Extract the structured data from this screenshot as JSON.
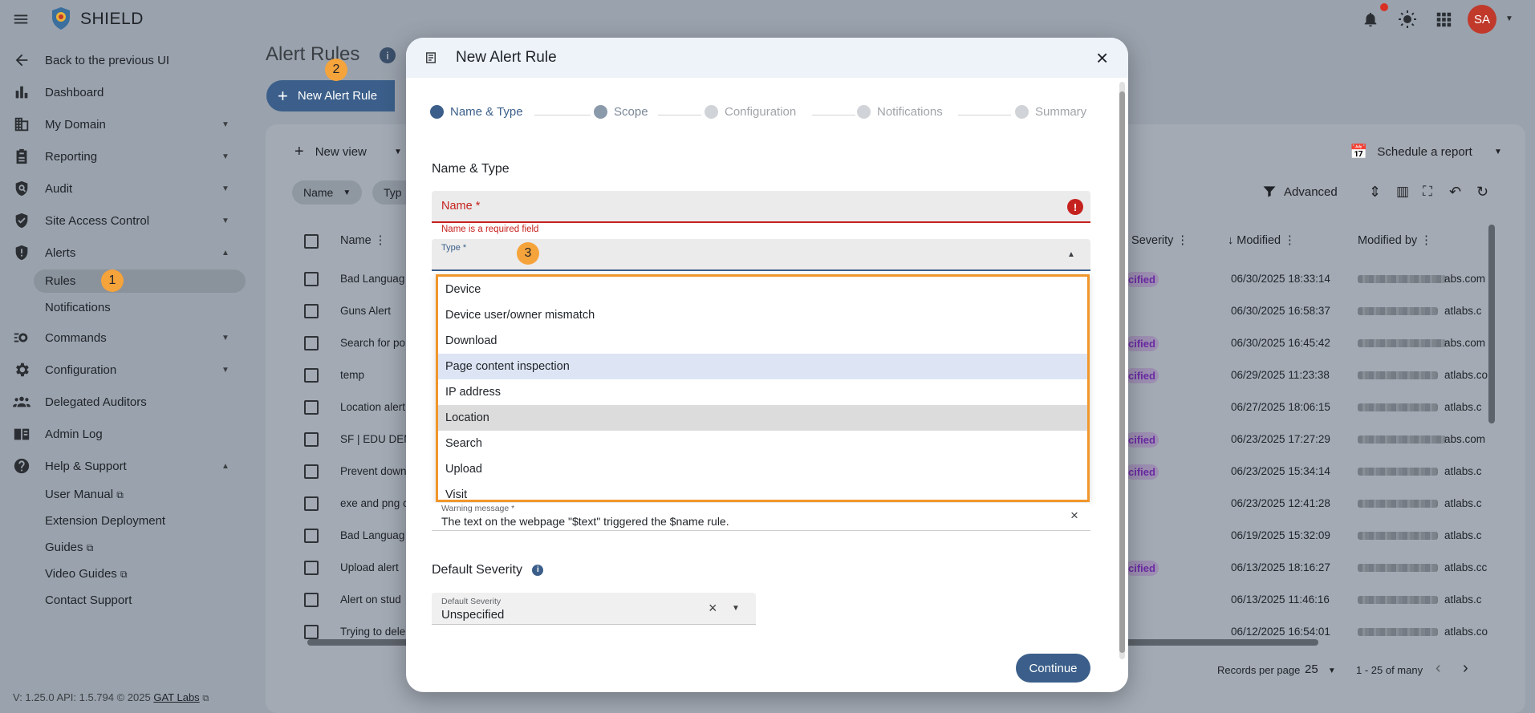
{
  "app": {
    "name": "SHIELD",
    "avatar": "SA"
  },
  "sidebar": {
    "back": "Back to the previous UI",
    "items": [
      {
        "label": "Dashboard"
      },
      {
        "label": "My Domain"
      },
      {
        "label": "Reporting"
      },
      {
        "label": "Audit"
      },
      {
        "label": "Site Access Control"
      },
      {
        "label": "Alerts"
      },
      {
        "label": "Commands"
      },
      {
        "label": "Configuration"
      },
      {
        "label": "Delegated Auditors"
      },
      {
        "label": "Admin Log"
      },
      {
        "label": "Help & Support"
      }
    ],
    "alerts_sub": [
      "Rules",
      "Notifications"
    ],
    "help_sub": [
      "User Manual",
      "Extension Deployment",
      "Guides",
      "Video Guides",
      "Contact Support"
    ],
    "footer": {
      "version": "V: 1.25.0  API: 1.5.794  © 2025",
      "link": "GAT Labs"
    }
  },
  "main": {
    "title": "Alert Rules",
    "new_rule_button": "New Alert Rule",
    "new_view": "New view",
    "schedule_report": "Schedule a report",
    "advanced": "Advanced",
    "filter_chips": [
      "Name",
      "Typ"
    ],
    "columns": {
      "name": "Name",
      "severity": "t Severity",
      "modified": "Modified",
      "modified_by": "Modified by"
    },
    "rows": [
      {
        "name": "Bad Languag",
        "severity": "cified",
        "modified": "06/30/2025 18:33:14",
        "by_tail": "abs.com"
      },
      {
        "name": "Guns Alert",
        "severity": "",
        "modified": "06/30/2025 16:58:37",
        "by_tail": "atlabs.c"
      },
      {
        "name": "Search for po",
        "severity": "cified",
        "modified": "06/30/2025 16:45:42",
        "by_tail": "abs.com"
      },
      {
        "name": "temp",
        "severity": "cified",
        "modified": "06/29/2025 11:23:38",
        "by_tail": "atlabs.co"
      },
      {
        "name": "Location alert",
        "severity": "",
        "modified": "06/27/2025 18:06:15",
        "by_tail": "atlabs.c"
      },
      {
        "name": "SF | EDU DEM",
        "severity": "cified",
        "modified": "06/23/2025 17:27:29",
        "by_tail": "abs.com"
      },
      {
        "name": "Prevent down",
        "severity": "cified",
        "modified": "06/23/2025 15:34:14",
        "by_tail": "atlabs.c"
      },
      {
        "name": "exe and png c",
        "severity": "",
        "modified": "06/23/2025 12:41:28",
        "by_tail": "atlabs.c"
      },
      {
        "name": "Bad Languag",
        "severity": "",
        "modified": "06/19/2025 15:32:09",
        "by_tail": "atlabs.c"
      },
      {
        "name": "Upload alert",
        "severity": "cified",
        "modified": "06/13/2025 18:16:27",
        "by_tail": "atlabs.cc"
      },
      {
        "name": "Alert on stud",
        "severity": "",
        "modified": "06/13/2025 11:46:16",
        "by_tail": "atlabs.c"
      },
      {
        "name": "Trying to dele",
        "severity": "",
        "modified": "06/12/2025 16:54:01",
        "by_tail": "atlabs.co"
      }
    ],
    "pagination": {
      "records_label": "Records per page",
      "per_page": "25",
      "range": "1 - 25 of many"
    }
  },
  "modal": {
    "title": "New Alert Rule",
    "steps": [
      "Name & Type",
      "Scope",
      "Configuration",
      "Notifications",
      "Summary"
    ],
    "section_name_type": "Name & Type",
    "name_field": {
      "label": "Name *",
      "error": "Name is a required field"
    },
    "type_field": {
      "label": "Type *"
    },
    "type_options": [
      "Device",
      "Device user/owner mismatch",
      "Download",
      "Page content inspection",
      "IP address",
      "Location",
      "Search",
      "Upload",
      "Visit"
    ],
    "warning_field": {
      "label": "Warning message *",
      "value": "The text on the webpage \"$text\" triggered the $name rule."
    },
    "section_severity": "Default Severity",
    "severity_field": {
      "label": "Default Severity",
      "value": "Unspecified"
    },
    "continue": "Continue"
  },
  "badges": [
    "1",
    "2",
    "3"
  ],
  "colors": {
    "primary": "#3b5f8a",
    "error": "#c5221f",
    "highlight": "#f0962b",
    "badge": "#f5a33b",
    "avatar": "#c0392b"
  }
}
